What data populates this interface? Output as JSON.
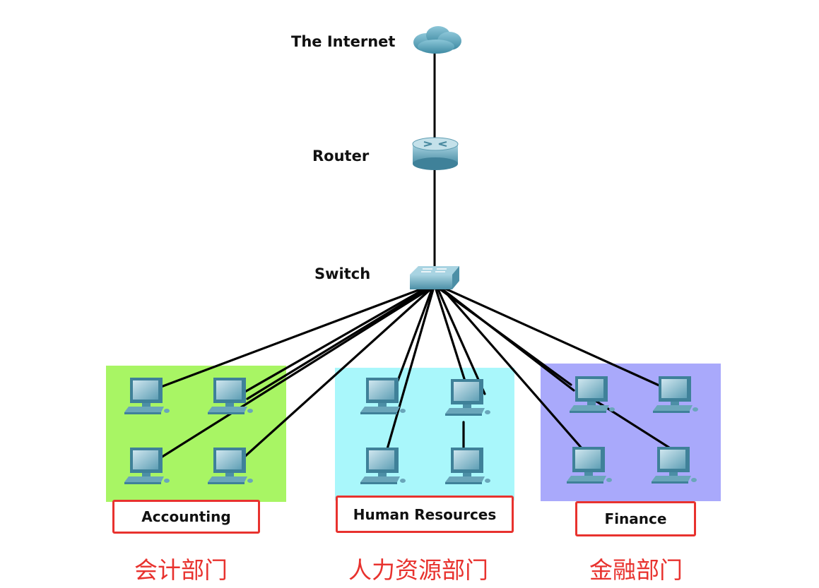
{
  "nodes": {
    "internet": "The Internet",
    "router": "Router",
    "switch": "Switch"
  },
  "departments": {
    "accounting": {
      "name": "Accounting",
      "name_cn": "会计部门",
      "color": "#a8f564"
    },
    "hr": {
      "name": "Human Resources",
      "name_cn": "人力资源部门",
      "color": "#a9f7fb"
    },
    "finance": {
      "name": "Finance",
      "name_cn": "金融部门",
      "color": "#a9a9fb"
    }
  },
  "colors": {
    "label_border": "#e8322e",
    "label_cn": "#e8322e",
    "link": "#000000"
  },
  "icons": [
    "cloud-icon",
    "router-icon",
    "switch-icon",
    "pc-icon"
  ]
}
